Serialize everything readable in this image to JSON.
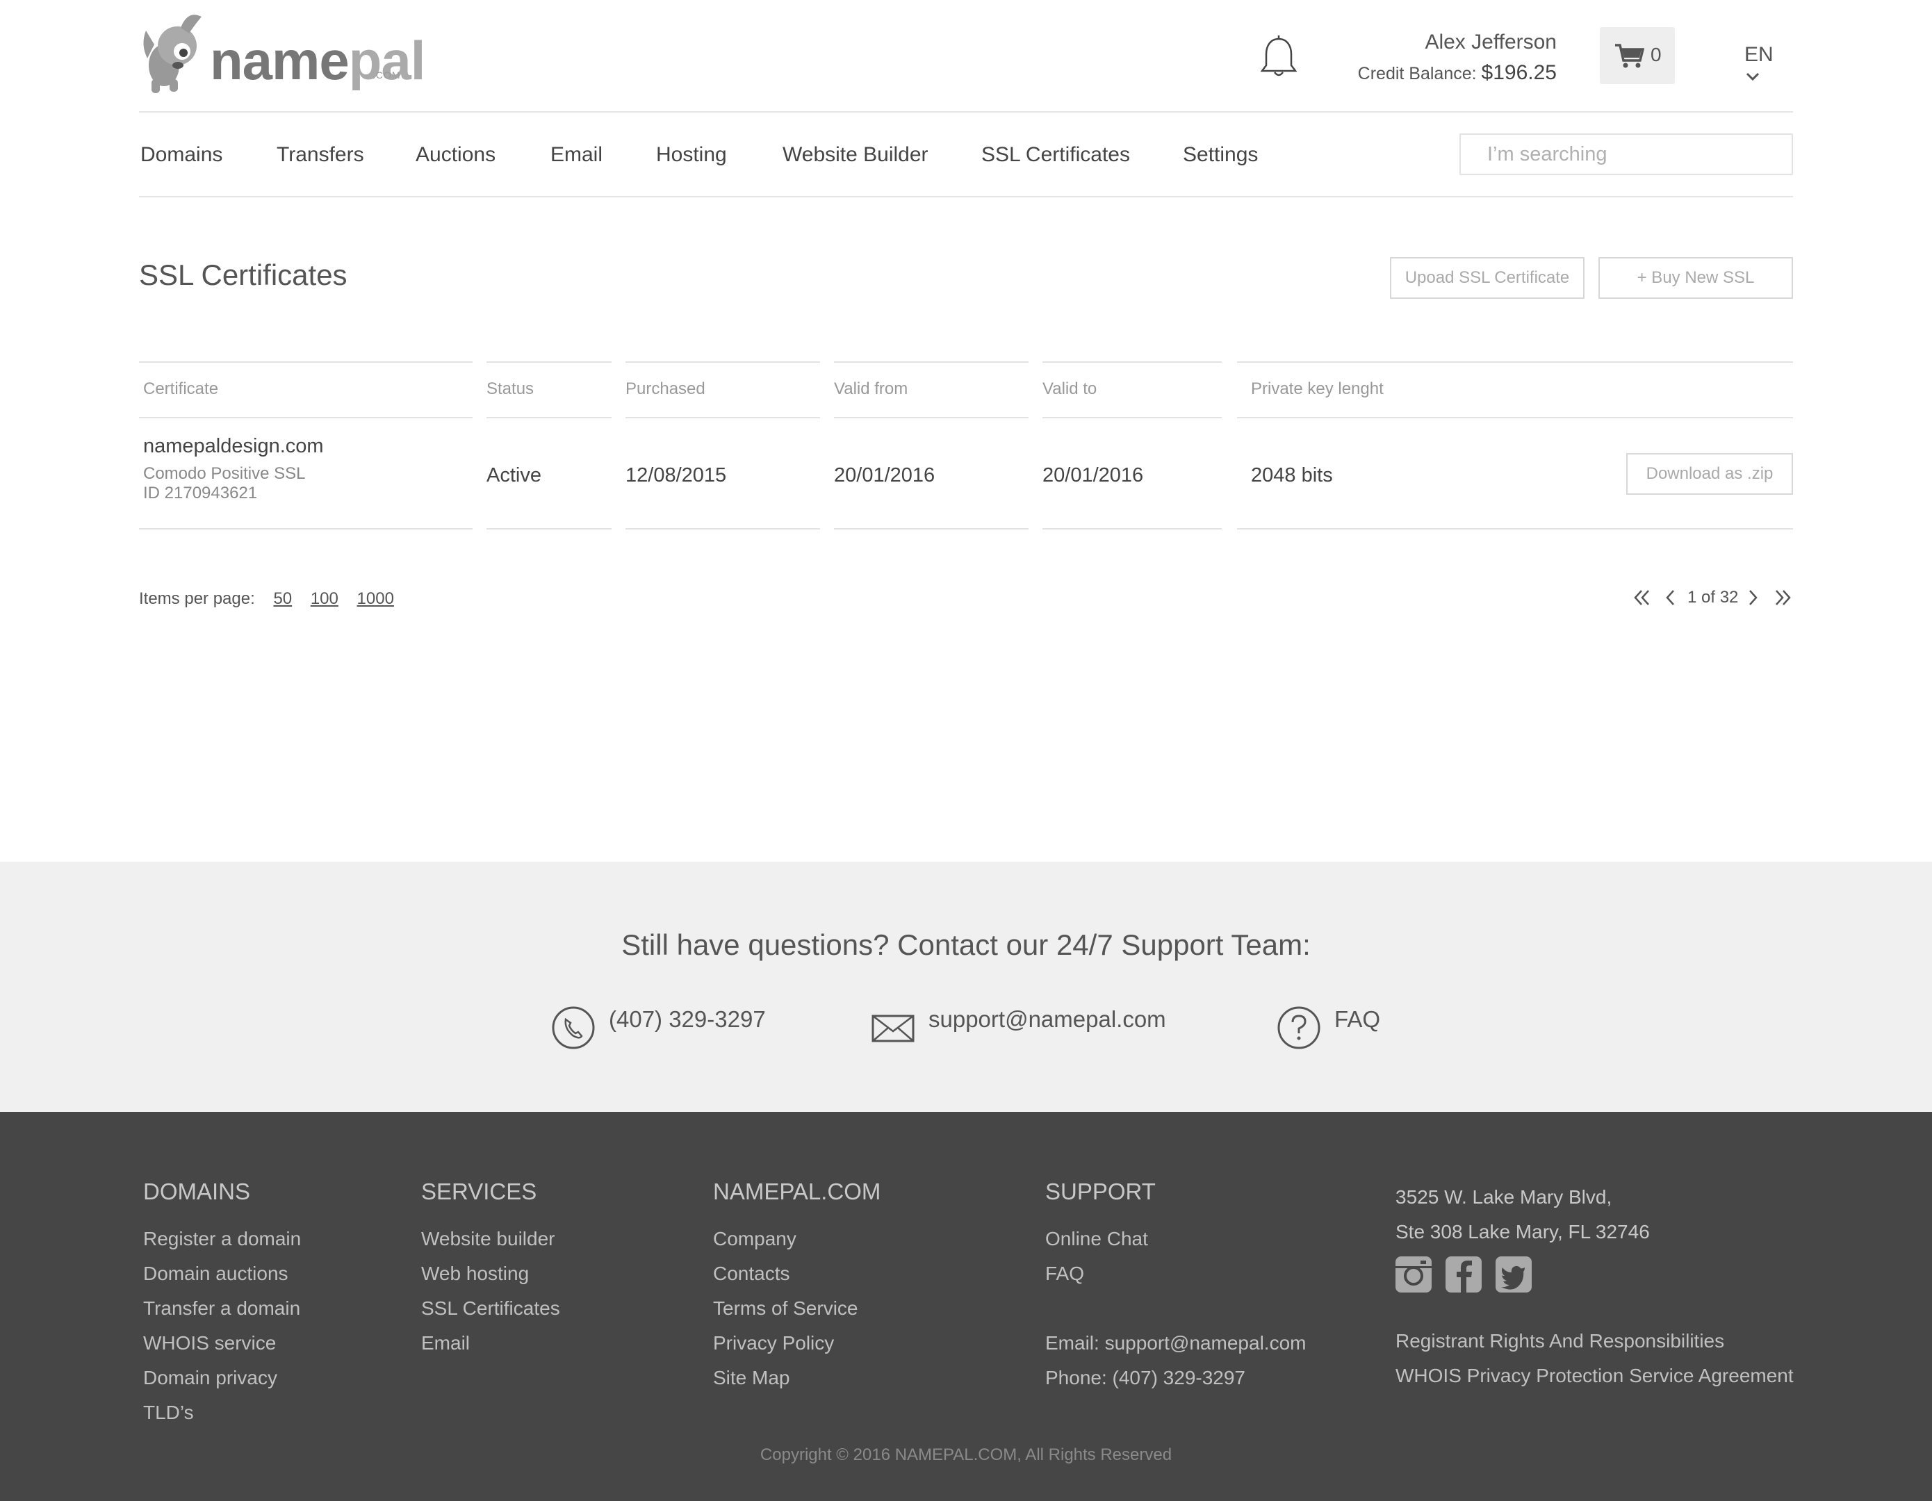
{
  "brand": {
    "name_part1": "name",
    "name_part2": "pal",
    "tld": ".COM"
  },
  "header": {
    "user_name": "Alex Jefferson",
    "credit_label": "Credit Balance:",
    "credit_amount": "$196.25",
    "cart_count": "0",
    "language": "EN"
  },
  "nav": {
    "items": [
      "Domains",
      "Transfers",
      "Auctions",
      "Email",
      "Hosting",
      "Website Builder",
      "SSL Certificates",
      "Settings"
    ],
    "search_placeholder": "I’m searching"
  },
  "page": {
    "title": "SSL Certificates",
    "upload_label": "Upoad SSL Certificate",
    "buy_label": "+ Buy New SSL"
  },
  "table": {
    "headers": [
      "Certificate",
      "Status",
      "Purchased",
      "Valid from",
      "Valid to",
      "Private key lenght"
    ],
    "rows": [
      {
        "domain": "namepaldesign.com",
        "type": "Comodo Positive SSL",
        "id": "ID 2170943621",
        "status": "Active",
        "purchased": "12/08/2015",
        "valid_from": "20/01/2016",
        "valid_to": "20/01/2016",
        "key_length": "2048 bits",
        "download_label": "Download as .zip"
      }
    ]
  },
  "pagination": {
    "items_per_page_label": "Items per page:",
    "options": [
      "50",
      "100",
      "1000"
    ],
    "page_info": "1 of 32"
  },
  "support": {
    "heading": "Still have questions? Contact our 24/7 Support Team:",
    "phone": "(407) 329-3297",
    "email": "support@namepal.com",
    "faq": "FAQ"
  },
  "footer": {
    "columns": [
      {
        "title": "DOMAINS",
        "links": [
          "Register a domain",
          "Domain auctions",
          "Transfer a domain",
          "WHOIS service",
          "Domain privacy",
          "TLD’s"
        ]
      },
      {
        "title": "SERVICES",
        "links": [
          "Website builder",
          "Web hosting",
          "SSL Certificates",
          "Email"
        ]
      },
      {
        "title": "NAMEPAL.COM",
        "links": [
          "Company",
          "Contacts",
          "Terms of Service",
          "Privacy Policy",
          "Site Map"
        ]
      },
      {
        "title": "SUPPORT",
        "links": [
          "Online Chat",
          "FAQ"
        ],
        "email_line": "Email: support@namepal.com",
        "phone_line": "Phone: (407) 329-3297"
      }
    ],
    "address_line1": "3525 W. Lake Mary Blvd,",
    "address_line2": "Ste 308 Lake Mary, FL 32746",
    "social": [
      "instagram-icon",
      "facebook-icon",
      "twitter-icon"
    ],
    "legal_links": [
      "Registrant Rights And Responsibilities",
      "WHOIS Privacy Protection Service Agreement"
    ],
    "copyright": "Copyright © 2016 NAMEPAL.COM, All Rights Reserved"
  },
  "colors": {
    "text": "#444444",
    "muted": "#999999",
    "border": "#e2e2e2",
    "support_bg": "#f0f0f0",
    "footer_bg": "#464646"
  }
}
